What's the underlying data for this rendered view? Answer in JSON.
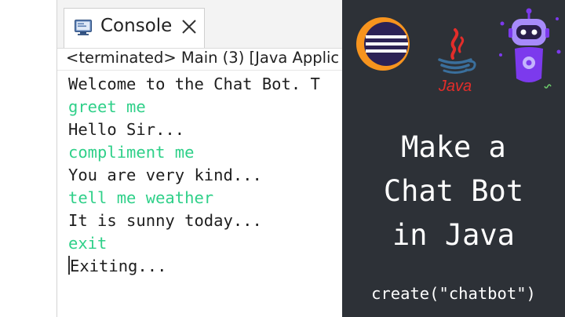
{
  "console": {
    "tab_label": "Console",
    "close_icon": "close-icon",
    "console_icon": "console-monitor-icon",
    "status": "<terminated> Main (3) [Java Applic",
    "lines": [
      {
        "text": "Welcome to the Chat Bot. T",
        "kind": "output"
      },
      {
        "text": "greet me",
        "kind": "input"
      },
      {
        "text": "Hello Sir...",
        "kind": "output"
      },
      {
        "text": "compliment me",
        "kind": "input"
      },
      {
        "text": "You are very kind...",
        "kind": "output"
      },
      {
        "text": "tell me weather",
        "kind": "input"
      },
      {
        "text": "It is sunny today...",
        "kind": "output"
      },
      {
        "text": "exit",
        "kind": "input"
      },
      {
        "text": "Exiting...",
        "kind": "output"
      }
    ],
    "colors": {
      "input": "#2fd089",
      "output": "#1e1e1e"
    }
  },
  "panel": {
    "logos": {
      "eclipse": "eclipse-logo-icon",
      "java": "java-logo-icon",
      "java_wordmark": "Java",
      "bot": "robot-icon"
    },
    "headline": [
      "Make a",
      "Chat Bot",
      "in Java"
    ],
    "tagline": "create(\"chatbot\")",
    "colors": {
      "background": "#2d3137",
      "text": "#ffffff",
      "eclipse_orange": "#f7941e",
      "eclipse_navy": "#2c2255",
      "java_red": "#e32d2a",
      "java_blue": "#3a6f9c",
      "bot_purple": "#7c3aed"
    }
  }
}
